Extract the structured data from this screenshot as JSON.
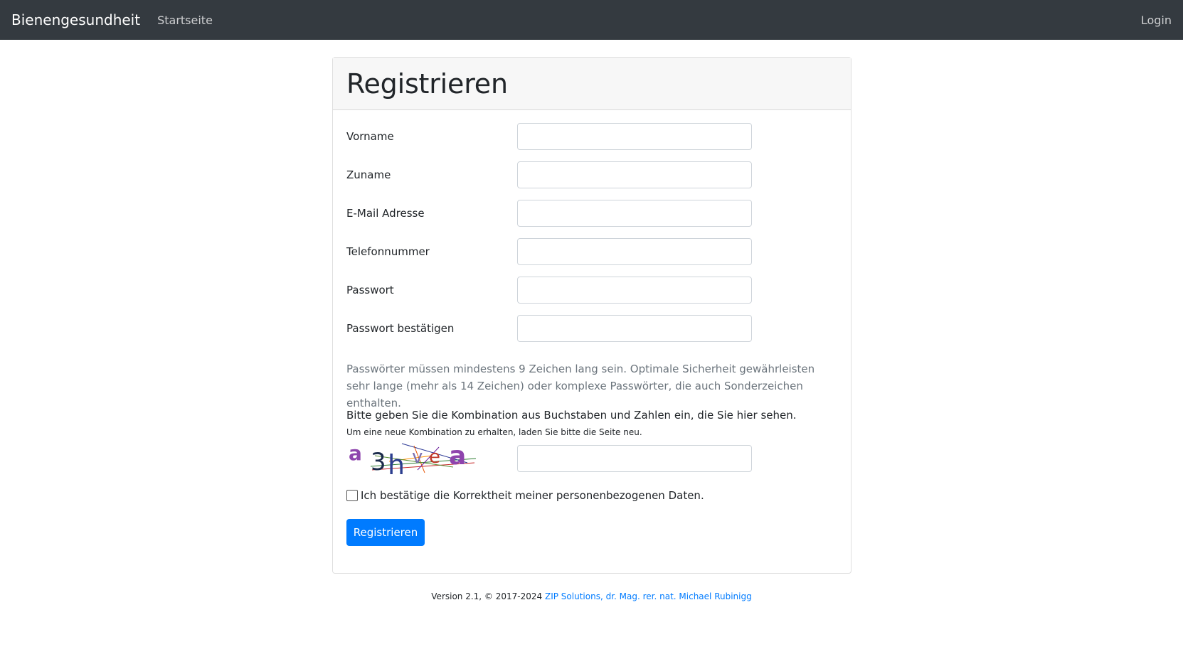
{
  "navbar": {
    "brand": "Bienengesundheit",
    "home_link": "Startseite",
    "login_link": "Login"
  },
  "card": {
    "title": "Registrieren"
  },
  "form": {
    "fields": [
      {
        "label": "Vorname",
        "value": ""
      },
      {
        "label": "Zuname",
        "value": ""
      },
      {
        "label": "E-Mail Adresse",
        "value": ""
      },
      {
        "label": "Telefonnummer",
        "value": ""
      },
      {
        "label": "Passwort",
        "value": ""
      },
      {
        "label": "Passwort bestätigen",
        "value": ""
      }
    ],
    "password_help": "Passwörter müssen mindestens 9 Zeichen lang sein. Optimale Sicherheit gewährleisten sehr lange (mehr als 14 Zeichen) oder komplexe Passwörter, die auch Sonderzeichen enthalten.",
    "captcha_heading": "Bitte geben Sie die Kombination aus Buchstaben und Zahlen ein, die Sie hier sehen.",
    "captcha_subtext": "Um eine neue Kombination zu erhalten, laden Sie bitte die Seite neu.",
    "captcha_text": "a3hvea",
    "captcha_value": "",
    "consent_label": "Ich bestätige die Korrektheit meiner personenbezogenen Daten.",
    "consent_checked": false,
    "submit_label": "Registrieren"
  },
  "footer": {
    "text": "Version 2.1, © 2017-2024",
    "link_text": "ZIP Solutions, dr. Mag. rer. nat. Michael Rubinigg"
  },
  "colors": {
    "navbar_bg": "#343a40",
    "primary": "#007bff",
    "muted_text": "#6c757d",
    "card_header_bg": "#f7f7f7"
  }
}
